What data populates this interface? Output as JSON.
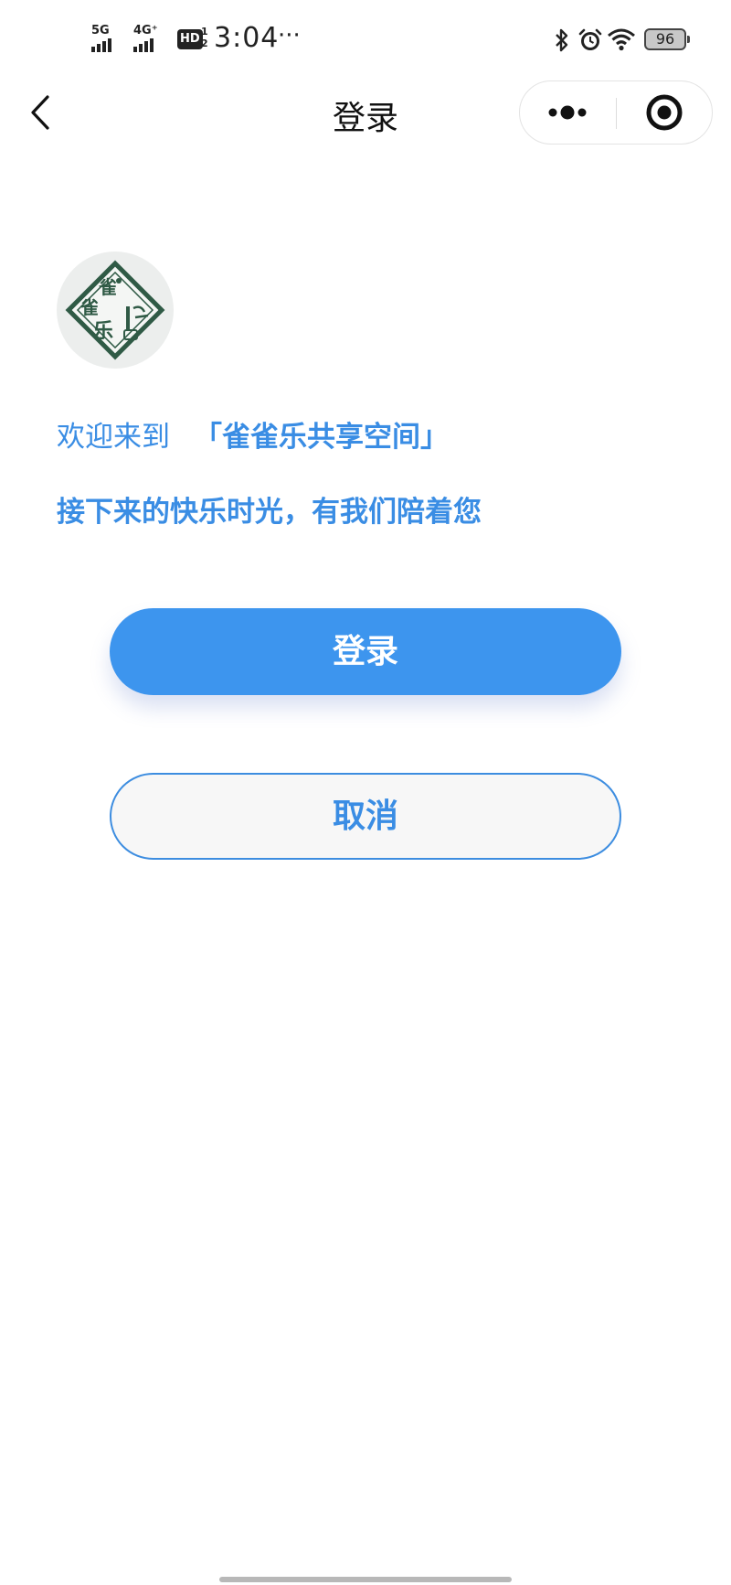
{
  "status_bar": {
    "network1": "5G",
    "network2": "4G⁺",
    "hd": "HD",
    "hd_sub": "1\n2",
    "time": "3:04",
    "more": "···",
    "battery": "96"
  },
  "nav": {
    "title": "登录",
    "back_icon": "chevron-left-icon",
    "menu_icon": "more-dots-icon",
    "close_icon": "target-close-icon"
  },
  "content": {
    "welcome_prefix": "欢迎来到",
    "brand_name": "「雀雀乐共享空间」",
    "subline": "接下来的快乐时光，有我们陪着您"
  },
  "buttons": {
    "login_label": "登录",
    "cancel_label": "取消"
  },
  "colors": {
    "accent": "#3d95ee",
    "text_accent": "#3a8de4",
    "logo_green": "#2f5a45"
  }
}
